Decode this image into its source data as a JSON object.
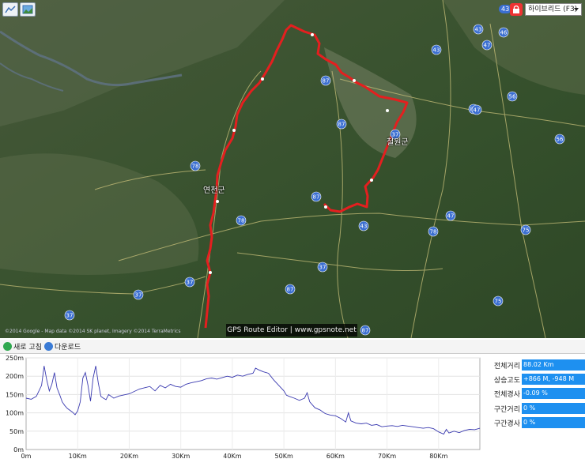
{
  "toolbar": {
    "home_icon": "map-home-icon",
    "layers_icon": "landscape-icon",
    "lock_icon": "lock-icon",
    "zoom_level": "43",
    "map_type": "하이브리드 (F3)"
  },
  "map": {
    "places": [
      "연천군",
      "철원군"
    ],
    "road_numbers": [
      "43",
      "46",
      "43",
      "87",
      "47",
      "56",
      "87",
      "87",
      "56",
      "78",
      "78",
      "47",
      "87",
      "43",
      "75",
      "47",
      "78",
      "37",
      "37",
      "37",
      "87",
      "75",
      "37",
      "87",
      "37"
    ],
    "credit": "GPS Route Editor | www.gpsnote.net",
    "copyright": "©2014 Google - Map data ©2014 SK planet, Imagery ©2014 TerraMetrics"
  },
  "actions": {
    "refresh": "새로 고침",
    "download": "다운로드"
  },
  "stats": [
    {
      "label": "전체거리",
      "value": "88.02 Km"
    },
    {
      "label": "상승고도",
      "value": "+866 M, -948 M"
    },
    {
      "label": "전체경사",
      "value": "-0.09 %"
    },
    {
      "label": "구간거리",
      "value": "0 %"
    },
    {
      "label": "구간경사",
      "value": "0 %"
    }
  ],
  "chart_data": {
    "type": "line",
    "title": "",
    "xlabel": "",
    "ylabel": "",
    "xlim": [
      0,
      88
    ],
    "ylim": [
      0,
      250
    ],
    "x_ticks": [
      "0m",
      "10Km",
      "20Km",
      "30Km",
      "40Km",
      "50Km",
      "60Km",
      "70Km",
      "80Km"
    ],
    "y_ticks": [
      "0m",
      "50m",
      "100m",
      "150m",
      "200m",
      "250m"
    ],
    "grid": true,
    "series": [
      {
        "x": [
          0,
          1,
          2,
          3,
          3.5,
          4,
          4.5,
          5,
          5.5,
          6,
          6.5,
          7,
          7.5,
          8,
          9,
          9.5,
          10,
          10.5,
          11,
          11.5,
          12,
          12.5,
          13,
          13.5,
          14,
          14.5,
          15,
          15.5,
          16,
          17,
          18,
          20,
          22,
          24,
          25,
          26,
          27,
          28,
          29,
          30,
          31,
          32,
          33,
          34,
          35,
          36,
          37,
          38,
          39,
          40,
          41,
          42,
          43,
          44,
          44.5,
          45,
          46,
          47,
          48,
          49,
          50,
          50.5,
          51,
          52,
          53,
          54,
          54.5,
          55,
          56,
          57,
          58,
          59,
          60,
          61,
          62,
          62.5,
          63,
          64,
          65,
          66,
          67,
          68,
          69,
          70,
          71,
          72,
          73,
          74,
          75,
          76,
          77,
          78,
          79,
          80,
          81,
          81.5,
          82,
          83,
          84,
          85,
          86,
          87,
          88
        ],
        "y": [
          140,
          137,
          145,
          175,
          228,
          190,
          160,
          178,
          210,
          168,
          150,
          130,
          120,
          112,
          102,
          95,
          105,
          130,
          195,
          210,
          175,
          132,
          195,
          228,
          182,
          145,
          140,
          136,
          150,
          140,
          146,
          152,
          165,
          172,
          160,
          175,
          168,
          178,
          172,
          170,
          178,
          182,
          185,
          188,
          193,
          195,
          192,
          196,
          200,
          197,
          203,
          200,
          205,
          208,
          222,
          218,
          212,
          208,
          190,
          175,
          160,
          148,
          145,
          140,
          134,
          140,
          155,
          130,
          114,
          108,
          98,
          94,
          92,
          85,
          75,
          100,
          78,
          72,
          70,
          72,
          66,
          68,
          62,
          64,
          65,
          63,
          66,
          64,
          62,
          60,
          58,
          60,
          57,
          48,
          42,
          55,
          45,
          50,
          46,
          52,
          55,
          54,
          58
        ]
      }
    ]
  }
}
